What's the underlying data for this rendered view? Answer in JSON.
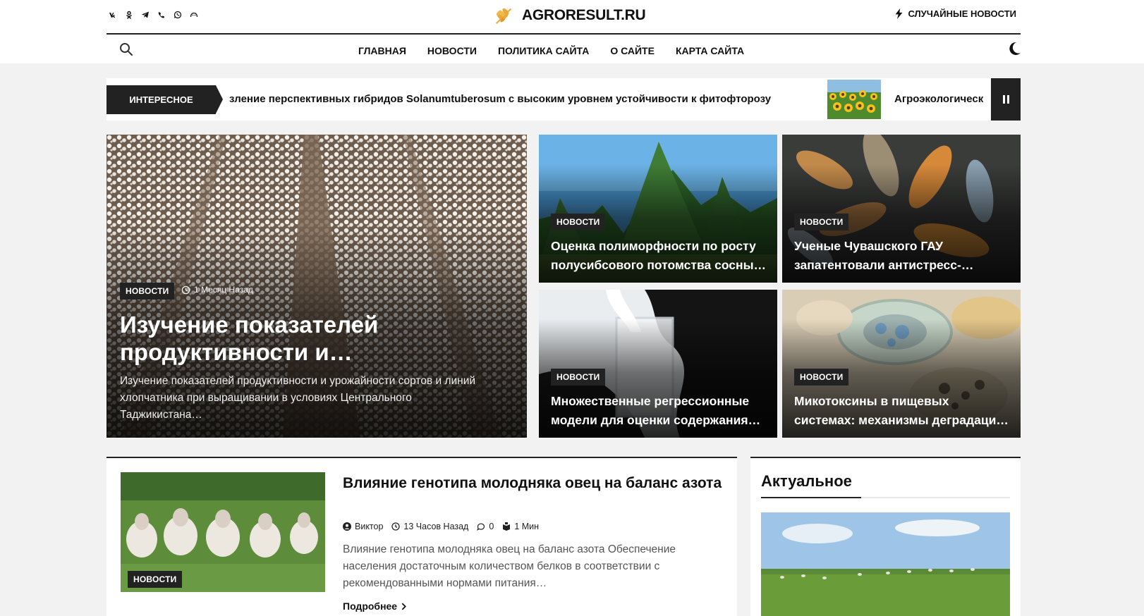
{
  "header": {
    "brand": "AGRORESULT.RU",
    "random_label": "СЛУЧАЙНЫЕ НОВОСТИ",
    "socials": [
      "vk-icon",
      "odnoklassniki-icon",
      "telegram-icon",
      "viber-icon",
      "whatsapp-icon",
      "max-icon"
    ]
  },
  "nav": {
    "items": [
      "ГЛАВНАЯ",
      "НОВОСТИ",
      "ПОЛИТИКА САЙТА",
      "О САЙТЕ",
      "КАРТА САЙТА"
    ]
  },
  "ticker": {
    "label": "ИНТЕРЕСНОЕ",
    "item1": "зление перспективных гибридов Solanumtuberosum с высоким уровнем устойчивости к фитофторозу",
    "item2": "Агроэкологическ"
  },
  "hero": {
    "category": "НОВОСТИ",
    "time": "1 Месяц Назад",
    "title": "Изучение показателей продуктивности и…",
    "excerpt": "Изучение показателей продуктивности и урожайности сортов и линий хлопчатника при выращивании в условиях Центрального Таджикистана…"
  },
  "cards": [
    {
      "category": "НОВОСТИ",
      "title": "Оценка полиморфности по росту полусибсового потомства сосны…"
    },
    {
      "category": "НОВОСТИ",
      "title": "Ученые Чувашского ГАУ запатентовали антистресс-…"
    },
    {
      "category": "НОВОСТИ",
      "title": "Множественные регрессионные модели для оценки содержания…"
    },
    {
      "category": "НОВОСТИ",
      "title": "Микотоксины в пищевых системах: механизмы деградаци…"
    }
  ],
  "post": {
    "category": "НОВОСТИ",
    "title": "Влияние генотипа молодняка овец на баланс азота",
    "author": "Виктор",
    "time": "13 Часов Назад",
    "comments": "0",
    "read": "1 Мин",
    "excerpt": "Влияние генотипа молодняка овец на баланс азота Обеспечение населения достаточным количеством белков в соответствии с рекомендованными нормами питания…",
    "more": "Подробнее"
  },
  "sidebar": {
    "title": "Актуальное"
  },
  "colors": {
    "dark": "#222222",
    "accent": "#e8a93a",
    "background": "#f2f2f2"
  }
}
